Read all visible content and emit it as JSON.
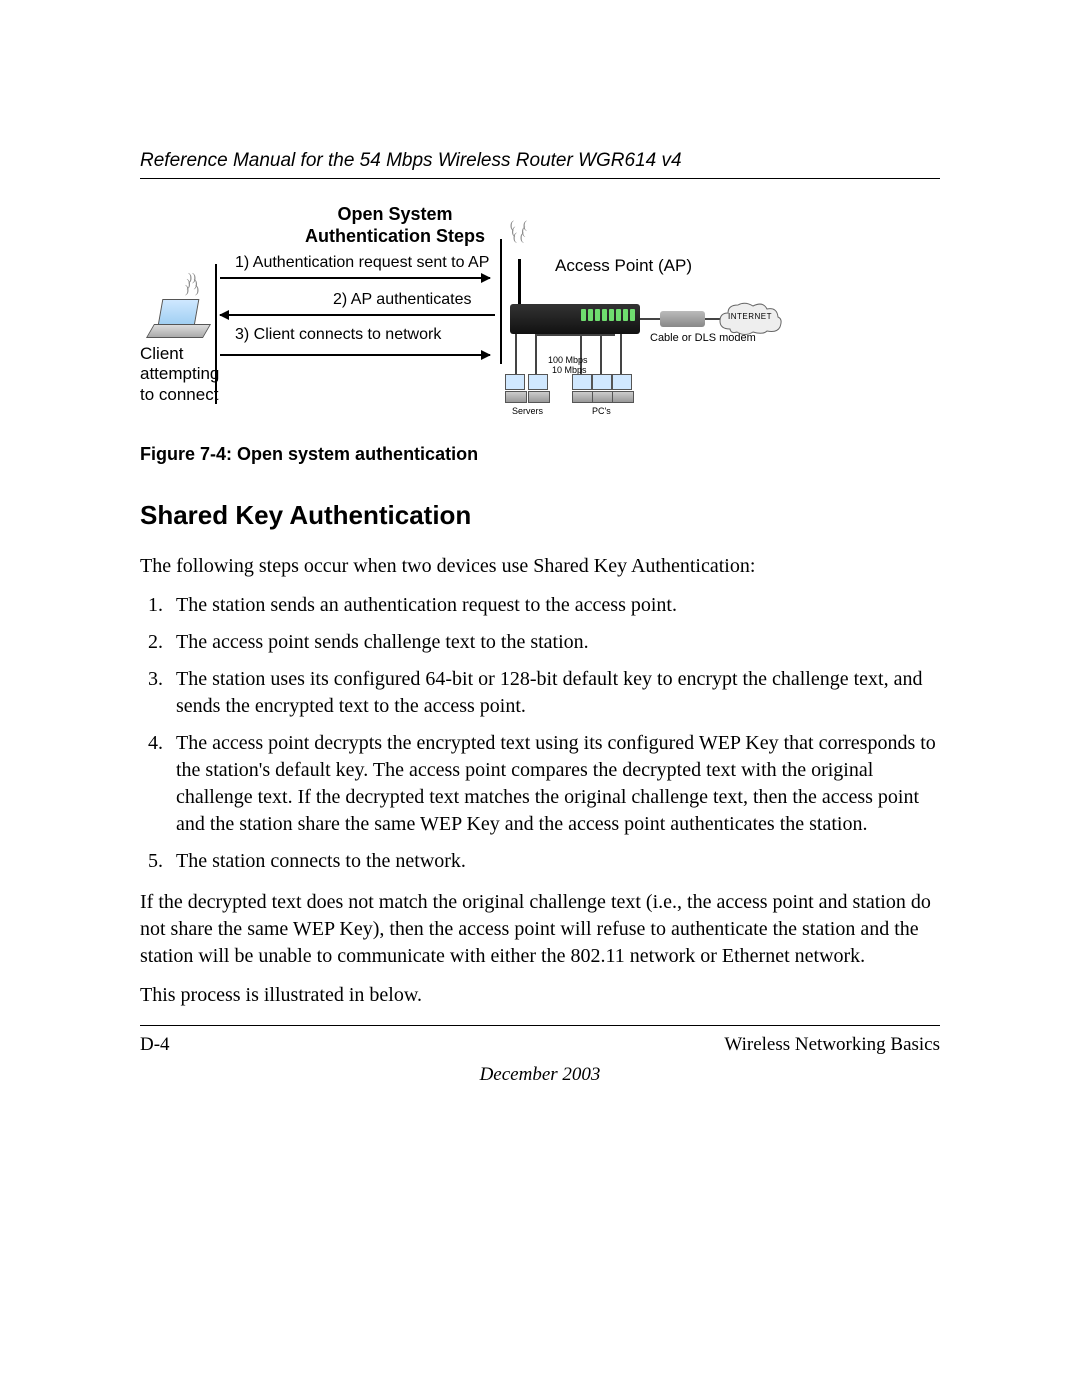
{
  "header": {
    "title": "Reference Manual for the 54 Mbps Wireless Router WGR614 v4"
  },
  "figure": {
    "title_line1": "Open System",
    "title_line2": "Authentication Steps",
    "step1": "1) Authentication request sent to AP",
    "step2": "2) AP authenticates",
    "step3": "3) Client connects to network",
    "client_label": "Client attempting to connect",
    "ap_label": "Access Point (AP)",
    "modem_label": "Cable or DLS modem",
    "cloud_label": "INTERNET",
    "speed1": "100 Mbps",
    "speed2": "10 Mbps",
    "servers_label": "Servers",
    "pcs_label": "PC's",
    "caption": "Figure 7-4:  Open system authentication"
  },
  "section": {
    "heading": "Shared Key Authentication",
    "intro": "The following steps occur when two devices use Shared Key Authentication:",
    "steps": [
      "The station sends an authentication request to the access point.",
      "The access point sends challenge text to the station.",
      "The station uses its configured 64-bit or 128-bit default key to encrypt the challenge text, and sends the encrypted text to the access point.",
      "The access point decrypts the encrypted text using its configured WEP Key that corresponds to the station's default key. The access point compares the decrypted text with the original challenge text. If the decrypted text matches the original challenge text, then the access point and the station share the same WEP Key and the access point authenticates the station.",
      "The station connects to the network."
    ],
    "para1": "If the decrypted text does not match the original challenge text (i.e., the access point and station do not share the same WEP Key), then the access point will refuse to authenticate the station and the station will be unable to communicate with either the 802.11 network or Ethernet network.",
    "para2": "This process is illustrated in below."
  },
  "footer": {
    "page_number": "D-4",
    "section_name": "Wireless Networking Basics",
    "date": "December 2003"
  }
}
